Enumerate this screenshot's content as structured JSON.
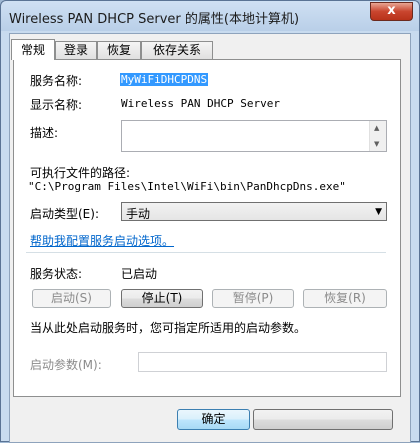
{
  "window": {
    "title": "Wireless PAN DHCP Server 的属性(本地计算机)",
    "close_glyph": "x"
  },
  "tabs": [
    {
      "label": "常规",
      "active": true
    },
    {
      "label": "登录",
      "active": false
    },
    {
      "label": "恢复",
      "active": false
    },
    {
      "label": "依存关系",
      "active": false
    }
  ],
  "general": {
    "service_name_label": "服务名称:",
    "service_name_value": "MyWiFiDHCPDNS",
    "display_name_label": "显示名称:",
    "display_name_value": "Wireless PAN DHCP Server",
    "description_label": "描述:",
    "exe_path_label": "可执行文件的路径:",
    "exe_path_value": "\"C:\\Program Files\\Intel\\WiFi\\bin\\PanDhcpDns.exe\"",
    "startup_type_label": "启动类型(E):",
    "startup_type_value": "手动",
    "help_link": "帮助我配置服务启动选项。",
    "status_label": "服务状态:",
    "status_value": "已启动",
    "buttons": {
      "start": "启动(S)",
      "stop": "停止(T)",
      "pause": "暂停(P)",
      "resume": "恢复(R)"
    },
    "hint_text": "当从此处启动服务时，您可指定所适用的启动参数。",
    "start_params_label": "启动参数(M):"
  },
  "footer": {
    "ok_label": "确定"
  }
}
